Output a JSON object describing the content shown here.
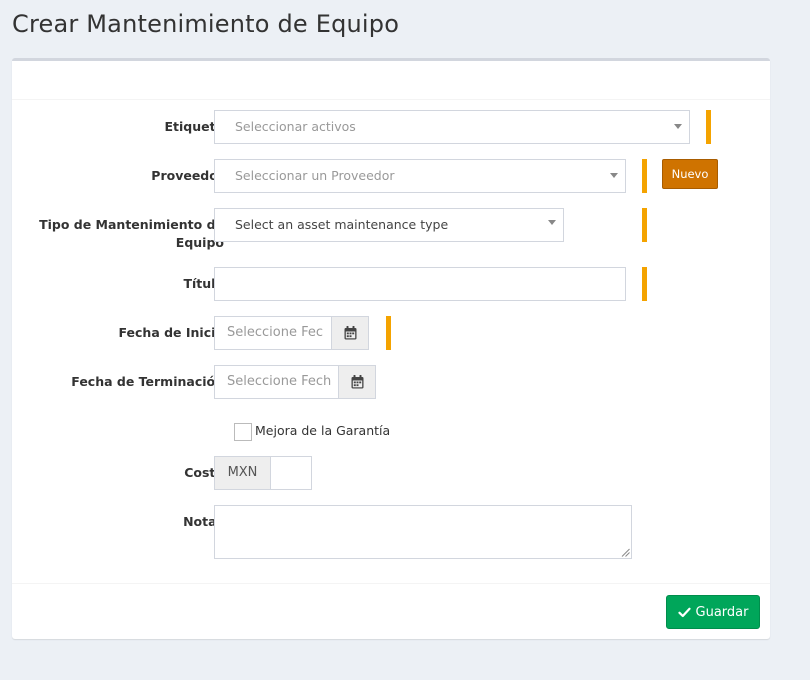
{
  "page": {
    "title": "Crear Mantenimiento de Equipo"
  },
  "form": {
    "etiqueta": {
      "label": "Etiqueta",
      "placeholder": "Seleccionar activos"
    },
    "proveedor": {
      "label": "Proveedor",
      "placeholder": "Seleccionar un Proveedor",
      "new_button": "Nuevo"
    },
    "tipo": {
      "label_line1": "Tipo de Mantenimiento de",
      "label_line2": "Equipo",
      "value": "Select an asset maintenance type"
    },
    "titulo": {
      "label": "Título",
      "value": ""
    },
    "fecha_inicio": {
      "label": "Fecha de Inicio",
      "placeholder": "Seleccione Fec"
    },
    "fecha_terminacion": {
      "label": "Fecha de Terminación",
      "placeholder": "Seleccione Fech"
    },
    "garantia": {
      "label": "Mejora de la Garantía",
      "checked": false
    },
    "costo": {
      "label": "Costo",
      "currency": "MXN",
      "value": ""
    },
    "notas": {
      "label": "Notas",
      "value": ""
    }
  },
  "footer": {
    "save_label": "Guardar"
  },
  "icons": {
    "calendar": "calendar-icon",
    "check": "check-icon",
    "caret": "caret-down-icon"
  },
  "colors": {
    "required_bar": "#f4a300",
    "new_button": "#cf7300",
    "save_button": "#00a65a"
  }
}
